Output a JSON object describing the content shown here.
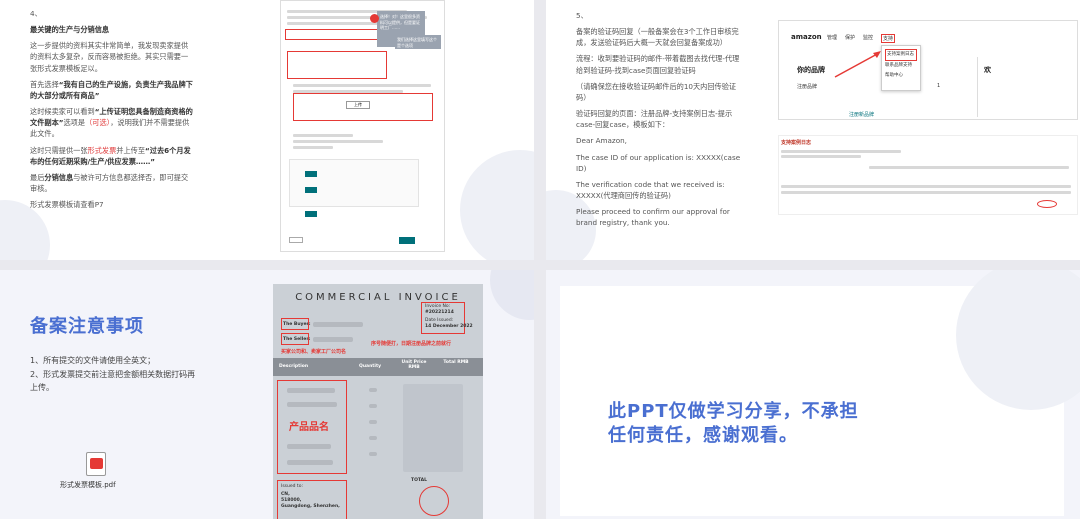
{
  "slide1": {
    "num": "4、",
    "heading": "最关键的生产与分销信息",
    "p1": "这一步提供的资料其实非常简单，我发现卖家提供的资料太多复杂，反而容易被拒绝。其实只需要一张形式发票模板足以。",
    "p2_a": "首先选择",
    "p2_b": "“我有自己的生产设施，负责生产我品牌下的大部分或所有商品”",
    "p3_a": "这时候卖家可以看到",
    "p3_b": "“上传证明您具备制造商资格的文件副本”",
    "p3_c": "选项是",
    "p3_d": "（可选）",
    "p3_e": "，说明我们并不需要提供此文件。",
    "p4_a": "这时只需提供一张",
    "p4_b": "形式发票",
    "p4_c": "并上传至",
    "p4_d": "“过去6个月发布的任何近期采购/生产/供应发票……”",
    "p5_a": "最后",
    "p5_b": "分销信息",
    "p5_c": "与被许可方信息",
    "p5_d": "都选择否，即可提交审核。",
    "p6": "形式发票模板请查看P7",
    "shot_note1": "选择！对！这里很多资料可以提供，但是要证明工厂……",
    "shot_note2": "我们选择这里填写这个是个选项",
    "shot_btn": "上传"
  },
  "slide2": {
    "num": "5、",
    "p1": "备案的验证码回复（一般备案会在3个工作日审核完成，发送验证码后大概一天就会回复备案成功）",
    "p2": "流程：收到要验证码的邮件-带着截图去找代理-代理给到验证码-找到case页面回复验证码",
    "p3": "（请确保您在接收验证码邮件后的10天内回传验证码）",
    "p4": "验证码回复的页面：注册品牌-支持案例日志-提示case-回复case，模板如下：",
    "p5": "Dear Amazon,",
    "p6": "The case ID of our application is: XXXXX(case ID)",
    "p7": "The verification code that we received is: XXXXX(代理商回传的验证码)",
    "p8": "Please proceed to confirm our approval for brand registry, thank you.",
    "amazon": {
      "logo": "amazon",
      "nav": [
        "管理",
        "保护",
        "监控",
        "支持"
      ],
      "menu": [
        "支持案例日志",
        "联系品牌支持",
        "帮助中心"
      ],
      "brand_title": "你的品牌",
      "brand_label": "注册品牌",
      "brand_count": "1",
      "brand_link": "注册新品牌",
      "right_title": "欢",
      "log_title": "支持案例日志"
    }
  },
  "slide3": {
    "title": "备案注意事项",
    "item1": "1、所有提交的文件请使用全英文；",
    "item2": "2、形式发票提交前注意把金额相关数据打码再上传。",
    "file_name": "形式发票模板.pdf",
    "invoice": {
      "title": "COMMERCIAL INVOICE",
      "buyer": "The Buyer:",
      "seller": "The Seller:",
      "inv_no_label": "Invoice No:",
      "inv_no": "#20221214",
      "date_label": "Date Issued:",
      "date": "14 December 2022",
      "note_left": "买家公司和、卖家工厂公司名",
      "note_right": "序号随便打，日期注册品牌之前就行",
      "col_desc": "Description",
      "col_qty": "Quantity",
      "col_price": "Unit Price RMB",
      "col_total": "Total RMB",
      "product_label": "产品品名",
      "issued_to": "Issued to:",
      "addr1": "CN,",
      "addr2": "518000,",
      "addr3": "Guangdong, Shenzhen,",
      "total": "TOTAL"
    }
  },
  "slide4": {
    "text1": "此PPT仅做学习分享，不承担",
    "text2": "任何责任，感谢观看。"
  },
  "colors": {
    "accent_blue": "#4a6fd1",
    "red": "#e53935",
    "teal": "#00707a"
  },
  "icons": {
    "pdf": "pdf-file-icon"
  }
}
